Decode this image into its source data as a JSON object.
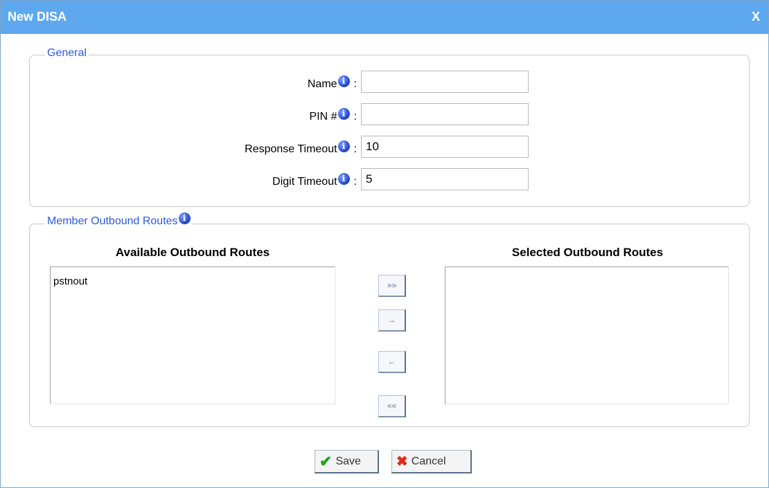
{
  "window": {
    "title": "New DISA",
    "close_label": "X"
  },
  "general": {
    "legend": "General",
    "fields": [
      {
        "label": "Name",
        "value": ""
      },
      {
        "label": "PIN #",
        "value": ""
      },
      {
        "label": "Response Timeout",
        "value": "10"
      },
      {
        "label": "Digit Timeout",
        "value": "5"
      }
    ],
    "separator": ":"
  },
  "routes": {
    "legend": "Member Outbound Routes",
    "available_title": "Available Outbound Routes",
    "selected_title": "Selected Outbound Routes",
    "available_items": [
      "pstnout"
    ],
    "selected_items": [],
    "buttons": {
      "move_all_right": "»»",
      "move_right": "→",
      "move_left": "←",
      "move_all_left": "««"
    }
  },
  "actions": {
    "save_label": "Save",
    "cancel_label": "Cancel"
  },
  "icons": {
    "info": "info-icon",
    "save": "check-icon",
    "cancel": "x-icon"
  },
  "colors": {
    "title_bar": "#5ea8ef",
    "legend_text": "#2a5bd7",
    "info_icon": "#1b3fc7"
  }
}
